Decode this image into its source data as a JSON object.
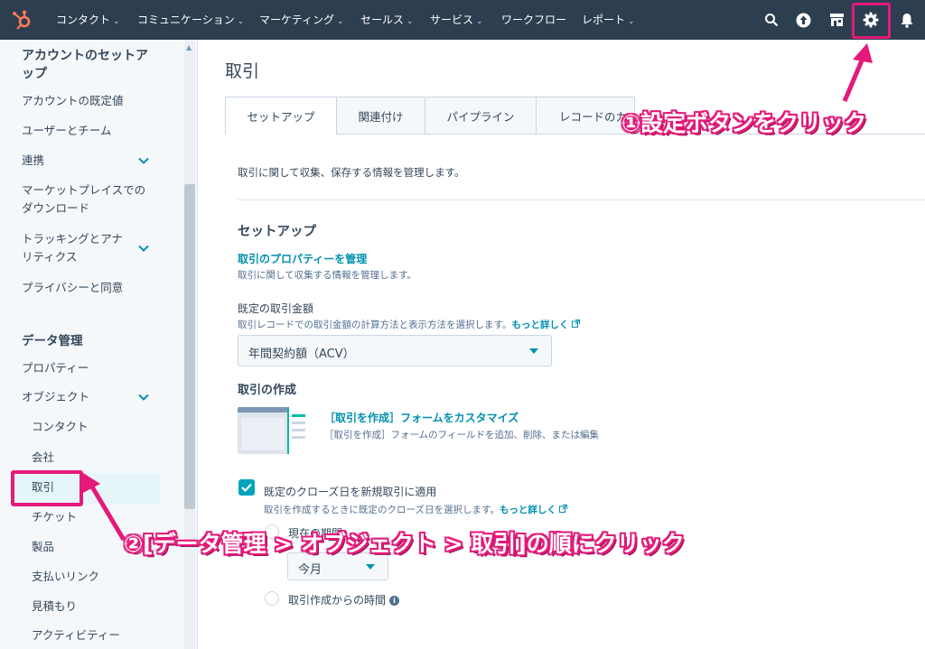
{
  "colors": {
    "nav_bg": "#2d3e50",
    "accent": "#0091ae",
    "highlight": "#e5197a",
    "checkbox": "#00a4bd",
    "sidebar_bg": "#f5f8fa"
  },
  "topnav": {
    "logo_icon": "hubspot-sprocket-icon",
    "items": [
      {
        "label": "コンタクト",
        "has_dropdown": true
      },
      {
        "label": "コミュニケーション",
        "has_dropdown": true
      },
      {
        "label": "マーケティング",
        "has_dropdown": true
      },
      {
        "label": "セールス",
        "has_dropdown": true
      },
      {
        "label": "サービス",
        "has_dropdown": true
      },
      {
        "label": "ワークフロー",
        "has_dropdown": false
      },
      {
        "label": "レポート",
        "has_dropdown": true
      }
    ],
    "icons": [
      "search-icon",
      "upgrade-icon",
      "marketplace-icon",
      "settings-icon",
      "notifications-icon"
    ]
  },
  "sidebar": {
    "title": "アカウントのセットアップ",
    "items": {
      "default": "アカウントの既定値",
      "users": "ユーザーとチーム",
      "integrations": "連携",
      "marketplace": "マーケットプレイスでのダウンロード",
      "tracking": "トラッキングとアナリティクス",
      "privacy": "プライバシーと同意"
    },
    "section_data": "データ管理",
    "data_items": {
      "properties": "プロパティー",
      "objects": "オブジェクト",
      "contacts": "コンタクト",
      "companies": "会社",
      "deals": "取引",
      "tickets": "チケット",
      "products": "製品",
      "payment_links": "支払いリンク",
      "quotes": "見積もり",
      "activities": "アクティビティー"
    }
  },
  "main": {
    "title": "取引",
    "tabs": [
      "セットアップ",
      "関連付け",
      "パイプライン",
      "レコードのカ"
    ],
    "description": "取引に関して収集、保存する情報を管理します。",
    "setup_heading": "セットアップ",
    "properties_link": "取引のプロパティーを管理",
    "properties_desc": "取引に関して収集する情報を管理します。",
    "amount_label": "既定の取引金額",
    "amount_desc": "取引レコードでの取引金額の計算方法と表示方法を選択します。",
    "more_link": "もっと詳しく",
    "amount_value": "年間契約額（ACV）",
    "create_heading": "取引の作成",
    "form_link": "［取引を作成］フォームをカスタマイズ",
    "form_desc": "［取引を作成］フォームのフィールドを追加、削除、または編集",
    "close_date_label": "既定のクローズ日を新規取引に適用",
    "close_date_desc": "取引を作成するときに既定のクローズ日を選択します。",
    "close_date_checked": true,
    "radio1_label": "現在の期間",
    "period_value": "今月",
    "radio2_label": "取引作成からの時間"
  },
  "annotations": {
    "step1": "①設定ボタンをクリック",
    "step2": "②[データ管理 > オブジェクト > 取引]の順にクリック"
  }
}
